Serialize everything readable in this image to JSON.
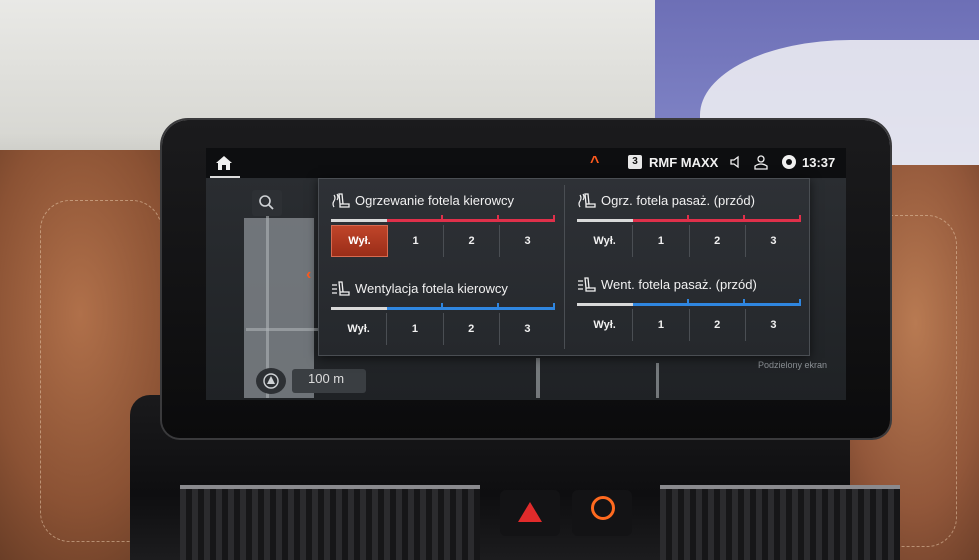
{
  "status_bar": {
    "station_preset": "3",
    "station_name": "RMF MAXX",
    "clock": "13:37"
  },
  "map": {
    "scale": "100 m",
    "split_screen_label": "Podzielony ekran"
  },
  "climate_popup": {
    "driver_heating": {
      "title": "Ogrzewanie fotela kierowcy",
      "levels": [
        "Wył.",
        "1",
        "2",
        "3"
      ],
      "selected": "Wył.",
      "bar_color": "#e0304a"
    },
    "passenger_heating": {
      "title": "Ogrz. fotela pasaż. (przód)",
      "levels": [
        "Wył.",
        "1",
        "2",
        "3"
      ],
      "selected": "Wył.",
      "bar_color": "#e0304a"
    },
    "driver_ventilation": {
      "title": "Wentylacja fotela kierowcy",
      "levels": [
        "Wył.",
        "1",
        "2",
        "3"
      ],
      "selected": "Wył.",
      "bar_color": "#2f86e0"
    },
    "passenger_ventilation": {
      "title": "Went. fotela pasaż. (przód)",
      "levels": [
        "Wył.",
        "1",
        "2",
        "3"
      ],
      "selected": "Wył.",
      "bar_color": "#2f86e0"
    }
  },
  "colors": {
    "accent": "#ff5a1e",
    "popup_bg": "#2e3136",
    "off_button": "#c0452a"
  }
}
